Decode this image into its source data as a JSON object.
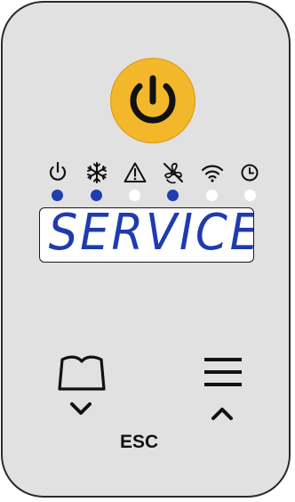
{
  "power": {
    "icon": "power-icon",
    "color": "#f3b72b"
  },
  "status_icons": [
    {
      "name": "standby-icon",
      "led": "on"
    },
    {
      "name": "snowflake-icon",
      "led": "on"
    },
    {
      "name": "warning-icon",
      "led": "off"
    },
    {
      "name": "fan-off-icon",
      "led": "on"
    },
    {
      "name": "wifi-icon",
      "led": "off"
    },
    {
      "name": "clock-icon",
      "led": "off"
    }
  ],
  "colors": {
    "led_on": "#1f3fae",
    "led_off": "#ffffff",
    "display_text": "#1f3bb0",
    "panel": "#e1e1e1"
  },
  "display": {
    "text": "SERVICE"
  },
  "buttons": {
    "left_icon": "book-icon",
    "left_arrow": "chevron-down-icon",
    "right_icon": "menu-icon",
    "right_arrow": "chevron-up-icon",
    "esc_label": "ESC"
  }
}
